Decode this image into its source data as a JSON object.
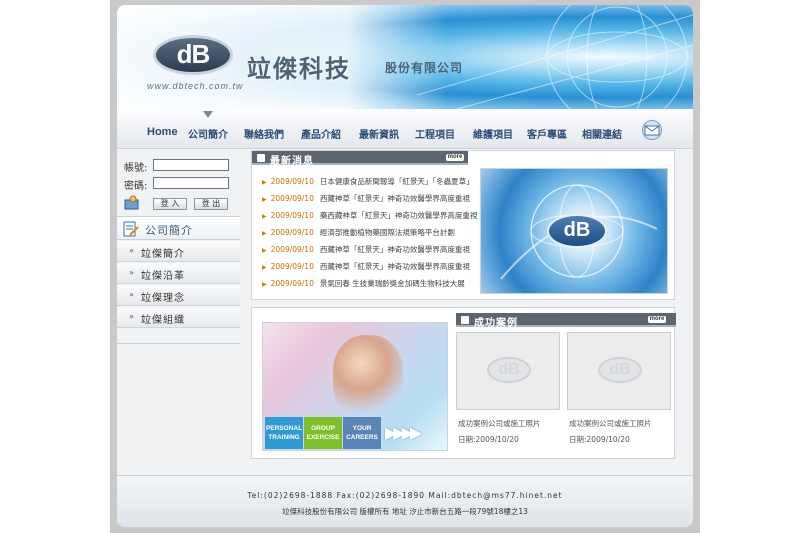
{
  "header": {
    "logo_text": "dB",
    "website": "www.dbtech.com.tw",
    "company_name": "竝傑科技",
    "company_suffix": "股份有限公司"
  },
  "nav": {
    "items": [
      "Home",
      "公司簡介",
      "聯絡我們",
      "產品介紹",
      "最新資訊",
      "工程項目",
      "維護項目",
      "客戶專區",
      "相關連結"
    ],
    "mail_icon": "envelope-icon"
  },
  "login": {
    "account_label": "帳號:",
    "password_label": "密碼:",
    "login_button": "登 入",
    "logout_button": "登 出"
  },
  "sidebar": {
    "title": "公司簡介",
    "items": [
      {
        "label": "竝傑簡介"
      },
      {
        "label": "竝傑沿革"
      },
      {
        "label": "竝傑理念"
      },
      {
        "label": "竝傑組織"
      }
    ]
  },
  "news": {
    "title": "最新消息",
    "more_label": "more",
    "items": [
      {
        "date": "2009/09/10",
        "text": "日本健康食品新聞報導「紅景天」「冬蟲夏草」"
      },
      {
        "date": "2009/09/10",
        "text": "西藏神草「紅景天」神奇功效醫學界高度重視"
      },
      {
        "date": "2009/09/10",
        "text": "藥西藏神草「紅景天」神奇功效醫學界高度重視"
      },
      {
        "date": "2009/09/10",
        "text": "經濟部推動植物藥國際法規策略平台計劃"
      },
      {
        "date": "2009/09/10",
        "text": "西藏神草「紅景天」神奇功效醫學界高度重視"
      },
      {
        "date": "2009/09/10",
        "text": "西藏神草「紅景天」神奇功效醫學界高度重視"
      },
      {
        "date": "2009/09/10",
        "text": "景氣回春 生技業瑞齡獎金加碼生物科技大展"
      }
    ]
  },
  "promo": {
    "tiles": [
      {
        "label": "PERSONAL TRAINING",
        "color": "#2f9bd6"
      },
      {
        "label": "GROUP EXERCISE",
        "color": "#7fbf2a"
      },
      {
        "label": "YOUR CAREERS",
        "color": "#5a84b8"
      }
    ]
  },
  "cases": {
    "title": "成功案例",
    "more_label": "more",
    "items": [
      {
        "title": "成功案例公司或施工照片",
        "date": "日期:2009/10/20"
      },
      {
        "title": "成功案例公司或施工照片",
        "date": "日期:2009/10/20"
      }
    ]
  },
  "footer": {
    "line1": "Tel:(02)2698-1888   Fax:(02)2698-1890   Mail:dbtech@ms77.hinet.net",
    "line2": "竝傑科技股份有限公司 版權所有   地址 汐止市新台五路一段79號18樓之13"
  }
}
